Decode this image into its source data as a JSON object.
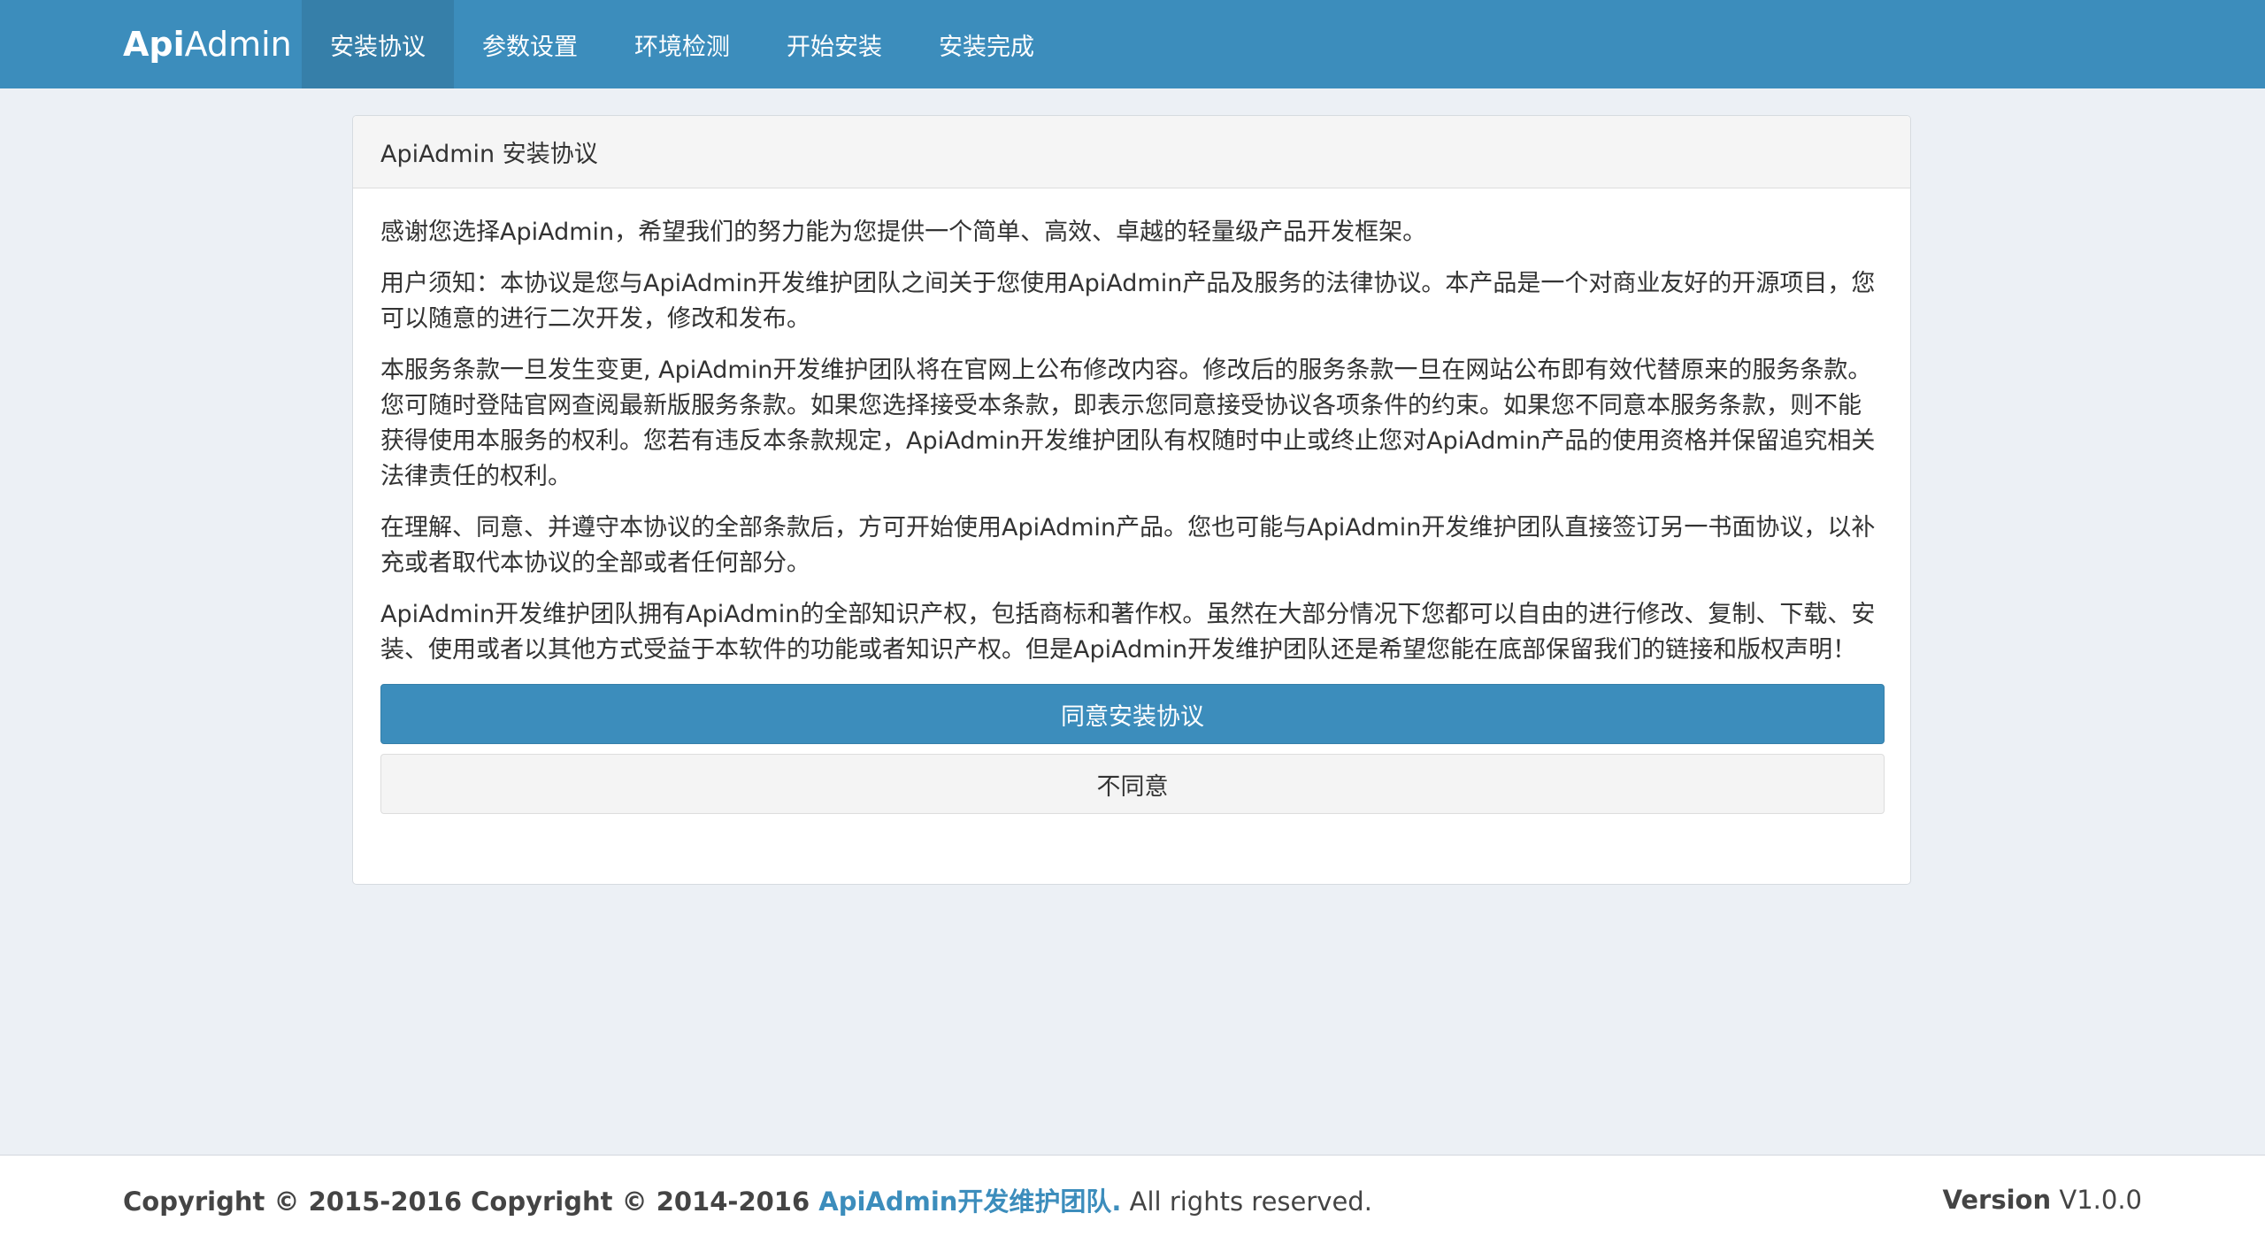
{
  "navbar": {
    "brand_bold": "Api",
    "brand_light": "Admin",
    "items": [
      {
        "label": "安装协议",
        "active": true
      },
      {
        "label": "参数设置",
        "active": false
      },
      {
        "label": "环境检测",
        "active": false
      },
      {
        "label": "开始安装",
        "active": false
      },
      {
        "label": "安装完成",
        "active": false
      }
    ]
  },
  "panel": {
    "title": "ApiAdmin 安装协议",
    "paragraphs": [
      "感谢您选择ApiAdmin，希望我们的努力能为您提供一个简单、高效、卓越的轻量级产品开发框架。",
      "用户须知：本协议是您与ApiAdmin开发维护团队之间关于您使用ApiAdmin产品及服务的法律协议。本产品是一个对商业友好的开源项目，您可以随意的进行二次开发，修改和发布。",
      "本服务条款一旦发生变更, ApiAdmin开发维护团队将在官网上公布修改内容。修改后的服务条款一旦在网站公布即有效代替原来的服务条款。您可随时登陆官网查阅最新版服务条款。如果您选择接受本条款，即表示您同意接受协议各项条件的约束。如果您不同意本服务条款，则不能获得使用本服务的权利。您若有违反本条款规定，ApiAdmin开发维护团队有权随时中止或终止您对ApiAdmin产品的使用资格并保留追究相关法律责任的权利。",
      "在理解、同意、并遵守本协议的全部条款后，方可开始使用ApiAdmin产品。您也可能与ApiAdmin开发维护团队直接签订另一书面协议，以补充或者取代本协议的全部或者任何部分。",
      "ApiAdmin开发维护团队拥有ApiAdmin的全部知识产权，包括商标和著作权。虽然在大部分情况下您都可以自由的进行修改、复制、下载、安装、使用或者以其他方式受益于本软件的功能或者知识产权。但是ApiAdmin开发维护团队还是希望您能在底部保留我们的链接和版权声明！"
    ],
    "agree_label": "同意安装协议",
    "disagree_label": "不同意"
  },
  "footer": {
    "copyright_prefix": "Copyright © 2015-2016 Copyright © 2014-2016 ",
    "team_link": "ApiAdmin开发维护团队.",
    "rights": " All rights reserved.",
    "version_label": "Version",
    "version_value": " V1.0.0"
  },
  "colors": {
    "primary": "#3c8dbc",
    "primary_dark": "#367fa9",
    "background": "#ecf0f5"
  }
}
